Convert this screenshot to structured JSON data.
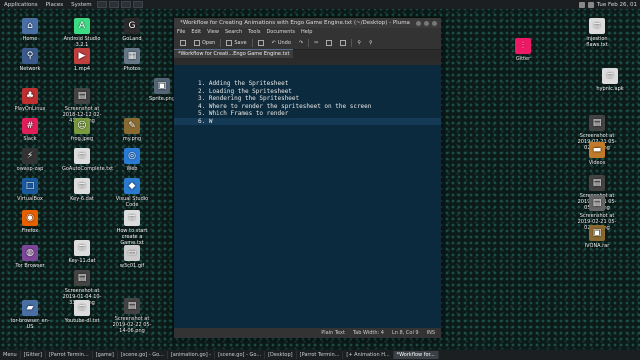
{
  "top_panel": {
    "menus": [
      "Applications",
      "Places",
      "System"
    ],
    "clock": "Tue Feb 26, 01"
  },
  "bottom_panel": {
    "tasks": [
      "Menu",
      "[Gitter]",
      "[Parrot Termin...",
      "[game]",
      "[scene.go] - Go...",
      "[animation.go] -",
      "[scene.go] - Go...",
      "[Desktop]",
      "[Parrot Termin...",
      "[+ Animation H...",
      "*Workflow for..."
    ]
  },
  "desktop": {
    "icons": [
      {
        "label": "Home",
        "color": "#4a6fa5",
        "glyph": "⌂"
      },
      {
        "label": "Android Studio 3.2.1",
        "color": "#3ddc84",
        "glyph": "A"
      },
      {
        "label": "GoLand",
        "color": "#2b2b2b",
        "glyph": "G"
      },
      {
        "label": "Network",
        "color": "#3b5b8c",
        "glyph": "⚲"
      },
      {
        "label": "1.mp4",
        "color": "#c04040",
        "glyph": "▶"
      },
      {
        "label": "Photos",
        "color": "#667788",
        "glyph": "▦"
      },
      {
        "label": "Sprite.png",
        "color": "#556677",
        "glyph": "▣"
      },
      {
        "label": "PlayOnLinux",
        "color": "#c03030",
        "glyph": "♣"
      },
      {
        "label": "Screenshot at 2018-12-12 02-41-48.png",
        "color": "#444",
        "glyph": "▤"
      },
      {
        "label": "Slack",
        "color": "#e01e5a",
        "glyph": "#"
      },
      {
        "label": "frog.jpeg",
        "color": "#7a9a40",
        "glyph": "☺"
      },
      {
        "label": "my.png",
        "color": "#8a6a30",
        "glyph": "✎"
      },
      {
        "label": "owasp-zap",
        "color": "#333",
        "glyph": "⚡"
      },
      {
        "label": "GoAutoComplete.txt",
        "color": "#dddddd",
        "glyph": "≡"
      },
      {
        "label": "Web",
        "color": "#2a7bd5",
        "glyph": "◎"
      },
      {
        "label": "VirtualBox",
        "color": "#1a5aa0",
        "glyph": "□"
      },
      {
        "label": "Key-6.dat",
        "color": "#dddddd",
        "glyph": "≡"
      },
      {
        "label": "Visual Studio Code",
        "color": "#2b7bd1",
        "glyph": "◆"
      },
      {
        "label": "Firefox",
        "color": "#e66000",
        "glyph": "◉"
      },
      {
        "label": "How to start create a Game.txt",
        "color": "#dddddd",
        "glyph": "≡"
      },
      {
        "label": "Tor Browser",
        "color": "#7d4698",
        "glyph": "◍"
      },
      {
        "label": "Key-11.dat",
        "color": "#dddddd",
        "glyph": "≡"
      },
      {
        "label": "w3c01.gif",
        "color": "#cccccc",
        "glyph": "▭"
      },
      {
        "label": "Screenshot at 2019-01-04 10-33-19.png",
        "color": "#444",
        "glyph": "▤"
      },
      {
        "label": "tor-browser_en-US",
        "color": "#4a6fa5",
        "glyph": "▰"
      },
      {
        "label": "Youtube-dl.txt",
        "color": "#dddddd",
        "glyph": "≡"
      },
      {
        "label": "Screenshot at 2019-02-22 05-14-06.png",
        "color": "#444",
        "glyph": "▤"
      },
      {
        "label": "Gitter",
        "color": "#ed1965",
        "glyph": "⫶"
      },
      {
        "label": "injestion flaws.txt",
        "color": "#dddddd",
        "glyph": "≡"
      },
      {
        "label": "hypnic.apk",
        "color": "#dddddd",
        "glyph": "≡"
      },
      {
        "label": "Screenshot at 2019-02-21 05-02-07.png",
        "color": "#444",
        "glyph": "▤"
      },
      {
        "label": "Videos",
        "color": "#c07a2a",
        "glyph": "▬"
      },
      {
        "label": "Screenshot at 2019-02-21 05-05-33.png",
        "color": "#444",
        "glyph": "▤"
      },
      {
        "label": "Screenshot at 2019-02-21 05-02-30.png",
        "color": "#666",
        "glyph": "▤"
      },
      {
        "label": "IVONA.rar",
        "color": "#8a6a30",
        "glyph": "▣"
      }
    ]
  },
  "window": {
    "title": "*Workflow for Creating Animations with Engo Game Engine.txt (~/Desktop) - Pluma",
    "menus": [
      "File",
      "Edit",
      "View",
      "Search",
      "Tools",
      "Documents",
      "Help"
    ],
    "toolbar": {
      "open": "Open",
      "save": "Save",
      "undo": "Undo"
    },
    "tab_label": "*Workflow for Creati...Engo Game Engine.txt",
    "lines": [
      "",
      "",
      "1. Adding the Spritesheet",
      "2. Loading the Spritesheet",
      "3. Rendering the Spritesheet",
      "4. Where to render the spritesheet on the screen",
      "5. Which Frames to render",
      "6. W"
    ],
    "current_line_index": 7,
    "status": {
      "mode": "Plain Text",
      "tab_width": "Tab Width: 4",
      "position": "Ln 8, Col 9",
      "ins": "INS"
    }
  }
}
